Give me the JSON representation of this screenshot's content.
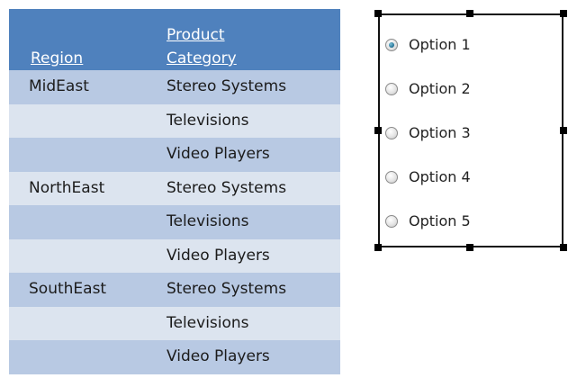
{
  "table": {
    "columns": [
      "Region",
      "Product\nCategory"
    ],
    "header": {
      "region": "Region",
      "category_line1": "Product",
      "category_line2": "Category"
    },
    "rows": [
      {
        "region": "MidEast",
        "category": "Stereo Systems"
      },
      {
        "region": "",
        "category": "Televisions"
      },
      {
        "region": "",
        "category": "Video Players"
      },
      {
        "region": "NorthEast",
        "category": "Stereo Systems"
      },
      {
        "region": "",
        "category": "Televisions"
      },
      {
        "region": "",
        "category": "Video Players"
      },
      {
        "region": "SouthEast",
        "category": "Stereo Systems"
      },
      {
        "region": "",
        "category": "Televisions"
      },
      {
        "region": "",
        "category": "Video Players"
      }
    ],
    "band_colors": [
      "#b8c9e3",
      "#dce4ef"
    ],
    "header_color": "#4f81bd"
  },
  "radio_group": {
    "selected_index": 0,
    "options": [
      {
        "label": "Option 1"
      },
      {
        "label": "Option 2"
      },
      {
        "label": "Option 3"
      },
      {
        "label": "Option 4"
      },
      {
        "label": "Option 5"
      }
    ]
  }
}
